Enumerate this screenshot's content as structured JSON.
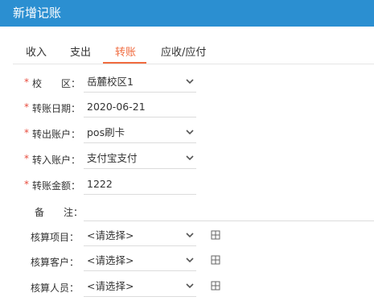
{
  "header": {
    "title": "新增记账"
  },
  "tabs": [
    {
      "label": "收入",
      "active": false
    },
    {
      "label": "支出",
      "active": false
    },
    {
      "label": "转账",
      "active": true
    },
    {
      "label": "应收/应付",
      "active": false
    }
  ],
  "form": {
    "campus": {
      "star": "*",
      "label": "校　　区：",
      "value": "岳麓校区1"
    },
    "date": {
      "star": "*",
      "label": "转账日期：",
      "value": "2020-06-21"
    },
    "out_account": {
      "star": "*",
      "label": "转出账户：",
      "value": "pos刷卡"
    },
    "in_account": {
      "star": "*",
      "label": "转入账户：",
      "value": "支付宝支付"
    },
    "amount": {
      "star": "*",
      "label": "转账金额：",
      "value": "1222"
    },
    "note": {
      "label": "备　　注：",
      "value": ""
    },
    "project": {
      "label": "核算项目：",
      "value": "<请选择>"
    },
    "customer": {
      "label": "核算客户：",
      "value": "<请选择>"
    },
    "person": {
      "label": "核算人员：",
      "value": "<请选择>"
    }
  },
  "colors": {
    "header_bg": "#2b8fd1",
    "accent": "#f06b3f",
    "required": "#e84c3d"
  }
}
